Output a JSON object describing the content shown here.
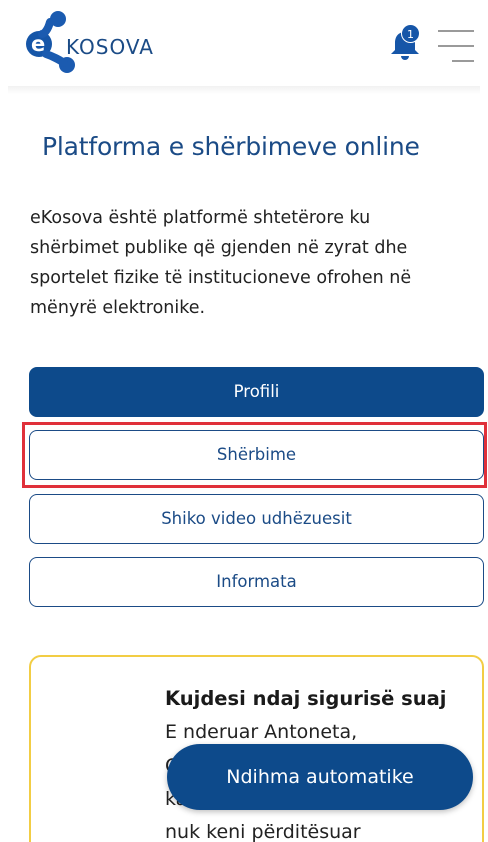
{
  "header": {
    "logo_text": "KOSOVA",
    "notification_count": "1",
    "icons": {
      "logo": "ekosova-logo-icon",
      "bell": "bell-icon",
      "menu": "hamburger-menu-icon"
    },
    "colors": {
      "brand": "#1b4b86",
      "logo_blue": "#1656a8"
    }
  },
  "hero": {
    "title": "Platforma e shërbimeve online",
    "intro_lines": [
      "eKosova është platformë shtetërore ku",
      "shërbimet publike që gjenden në zyrat dhe",
      "sportelet fizike të institucioneve ofrohen në",
      "mënyrë elektronike."
    ]
  },
  "actions": {
    "profile_label": "Profili",
    "services_label": "Shërbime",
    "video_label": "Shiko video udhëzuesit",
    "info_label": "Informata",
    "colors": {
      "primary": "#0d4a8b",
      "highlight": "#e0303a"
    }
  },
  "notice": {
    "title": "Kujdesi ndaj sigurisë suaj",
    "lines": [
      "E nderuar Antoneta,",
      "O",
      "ka",
      "nuk keni përditësuar"
    ],
    "colors": {
      "border": "#f2cd44"
    }
  },
  "assistant": {
    "label": "Ndihma automatike"
  }
}
